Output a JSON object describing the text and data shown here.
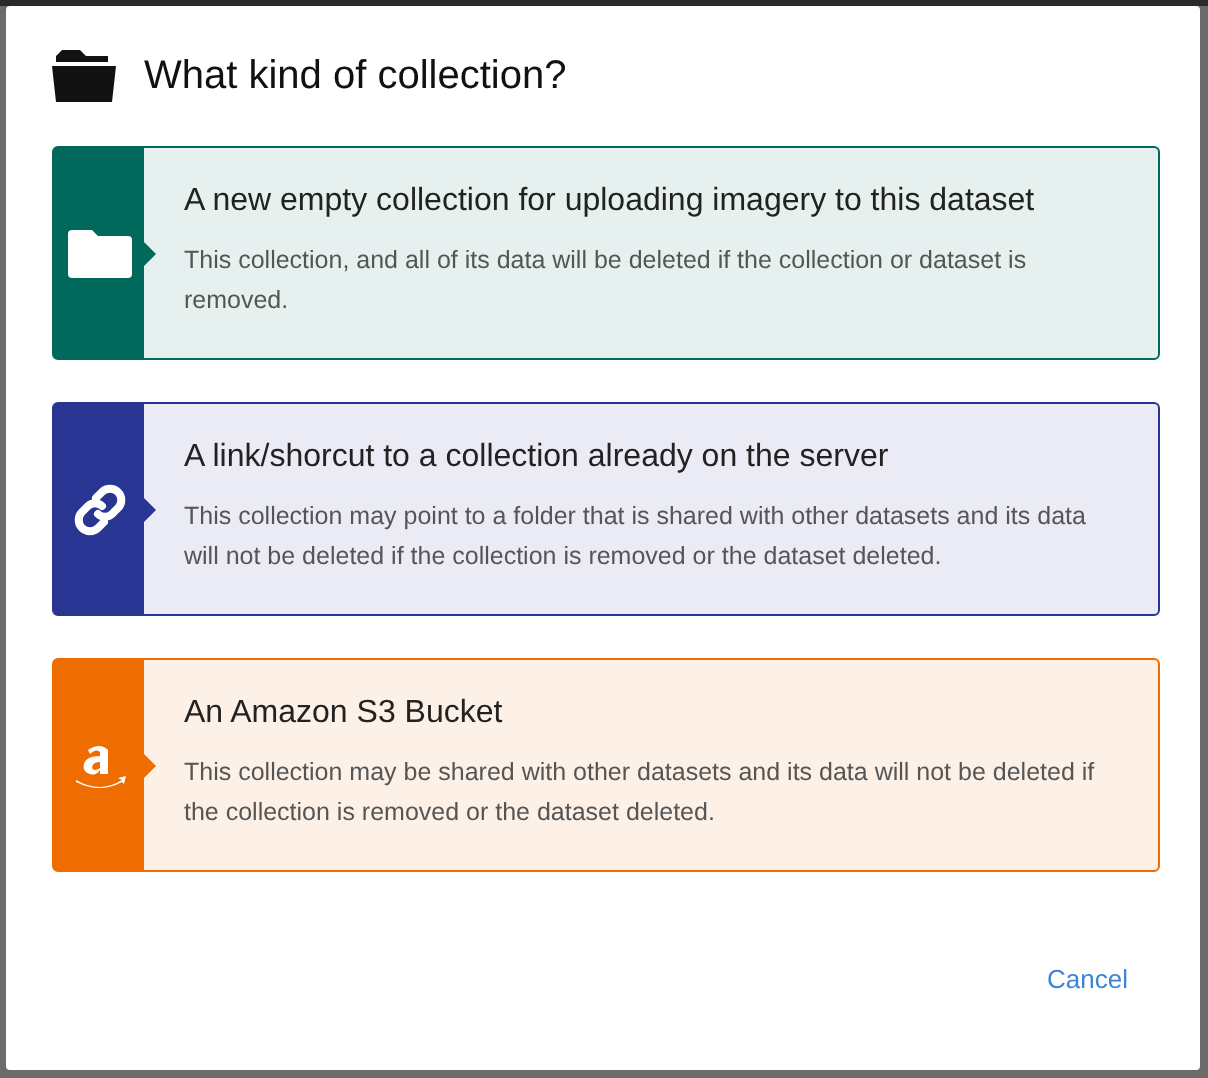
{
  "dialog": {
    "title": "What kind of collection?",
    "options": [
      {
        "kind": "folder",
        "color": "#00695c",
        "title": "A new empty collection for uploading imagery to this dataset",
        "description": "This collection, and all of its data will be deleted if the collection or dataset is removed."
      },
      {
        "kind": "link",
        "color": "#283593",
        "title": "A link/shorcut to a collection already on the server",
        "description": "This collection may point to a folder that is shared with other datasets and its data will not be deleted if the collection is removed or the dataset deleted."
      },
      {
        "kind": "amazon",
        "color": "#ef6c00",
        "title": "An Amazon S3 Bucket",
        "description": "This collection may be shared with other datasets and its data will not be deleted if the collection is removed or the dataset deleted."
      }
    ],
    "buttons": [
      {
        "label": "Cancel"
      }
    ]
  }
}
